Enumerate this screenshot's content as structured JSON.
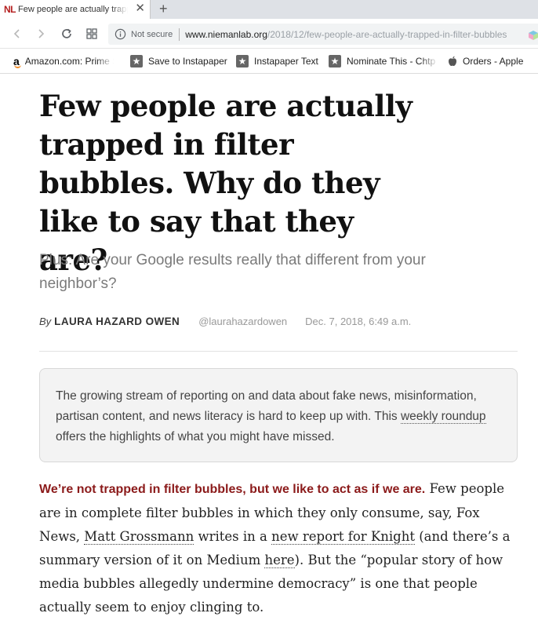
{
  "browser": {
    "tab": {
      "favicon_text": "NL",
      "title": "Few people are actually trapped in filter bubbles. Why do they like to say that they are?",
      "close_glyph": "✕"
    },
    "new_tab_glyph": "+",
    "address_bar": {
      "security_label": "Not secure",
      "url_domain": "www.niemanlab.org",
      "url_path": "/2018/12/few-people-are-actually-trapped-in-filter-bubbles"
    },
    "bookmarks": [
      {
        "label": "Amazon.com: Prime S",
        "icon": "amazon-icon"
      },
      {
        "label": "Save to Instapaper",
        "icon": "star-icon"
      },
      {
        "label": "Instapaper Text",
        "icon": "star-icon"
      },
      {
        "label": "Nominate This - Chtp",
        "icon": "star-icon"
      },
      {
        "label": "Orders - Apple",
        "icon": "apple-icon"
      }
    ]
  },
  "article": {
    "headline": "Few people are actually trapped in filter bubbles. Why do they like to say that they are?",
    "dek": "Plus: Are your Google results really that different from your neighbor’s?",
    "byline": {
      "by": "By",
      "author": "LAURA HAZARD OWEN",
      "handle": "@laurahazardowen",
      "date": "Dec. 7, 2018, 6:49 a.m."
    },
    "callout": {
      "text_before": "The growing stream of reporting on and data about fake news, misinformation, partisan content, and news literacy is hard to keep up with. This ",
      "link_text": "weekly roundup",
      "text_after": " offers the highlights of what you might have missed."
    },
    "body": {
      "lede": "We’re not trapped in filter bubbles, but we like to act as if we are.",
      "part1": " Few people are in complete filter bubbles in which they only consume, say, Fox News, ",
      "link1": "Matt Grossmann",
      "part2": " writes in a ",
      "link2": "new report for Knight",
      "part3": " (and there’s a summary version of it on Medium ",
      "link3": "here",
      "part4": "). But the “popular story of how media bubbles allegedly undermine democracy” is one that people actually seem to enjoy clinging to."
    }
  },
  "colors": {
    "accent_red": "#8b1a1a",
    "favicon_red": "#b41e1e",
    "dek_gray": "#7a7a7a"
  }
}
